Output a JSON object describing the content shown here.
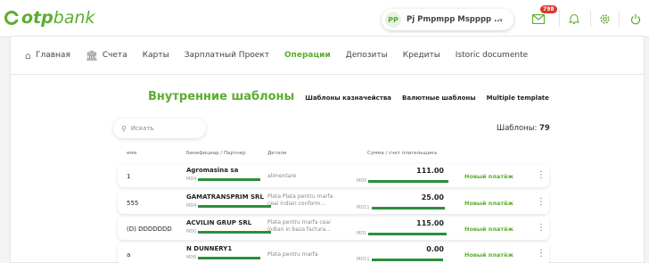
{
  "app": {
    "logo_prefix": "otp",
    "logo_suffix": "bank"
  },
  "user": {
    "initials": "PP",
    "name": "Pj Pmpmpp Mspppp ..."
  },
  "notifications": {
    "badge": "798"
  },
  "nav": [
    {
      "label": "Главная",
      "icon": "home-icon"
    },
    {
      "label": "Счета",
      "icon": "bank-icon"
    },
    {
      "label": "Карты"
    },
    {
      "label": "Зарплатный Проект"
    },
    {
      "label": "Операции",
      "active": true
    },
    {
      "label": "Депозиты"
    },
    {
      "label": "Кредиты"
    },
    {
      "label": "Istoric documente"
    }
  ],
  "subnav": {
    "title": "Внутренние шаблоны",
    "links": [
      "Шаблоны казначейства",
      "Валютные шаблоны",
      "Multiple template"
    ]
  },
  "search": {
    "placeholder": "Искать"
  },
  "count": {
    "label": "Шаблоны:",
    "value": "79"
  },
  "columns": {
    "name": "имя",
    "beneficiary": "Бенефициар / Партнер",
    "details": "Детали",
    "amount": "Сумма / счет плательщика"
  },
  "rows": [
    {
      "name": "1",
      "beneficiary": "Agromasina sa",
      "acc_prefix": "MD4",
      "details_1": "alimentare",
      "details_2": "",
      "amount": "111.00",
      "amount_acc_prefix": "MD0",
      "action": "Новый платёж"
    },
    {
      "name": "555",
      "beneficiary": "GAMATRANSPRIM SRL",
      "acc_prefix": "MD4",
      "details_1": "Plata Plata pentru marfa",
      "details_2": "ceai indian conform...",
      "amount": "25.00",
      "amount_acc_prefix": "MD11",
      "action": "Новый платёж"
    },
    {
      "name": "(D) DDDDDDD",
      "beneficiary": "ACVILIN GRUP SRL",
      "acc_prefix": "MD0",
      "details_1": "Plata pentru marfa ceai",
      "details_2": "indian in baza factura...",
      "amount": "115.00",
      "amount_acc_prefix": "MD1",
      "action": "Новый платёж"
    },
    {
      "name": "a",
      "beneficiary": "N DUNNERY1",
      "acc_prefix": "MD6",
      "details_1": "Plata pentru marfa",
      "details_2": "",
      "amount": "0.00",
      "amount_acc_prefix": "MD11",
      "action": "Новый платёж"
    }
  ],
  "colors": {
    "accent": "#5aae2e",
    "badge": "#e0362b",
    "mask": "#2a8f3b"
  }
}
